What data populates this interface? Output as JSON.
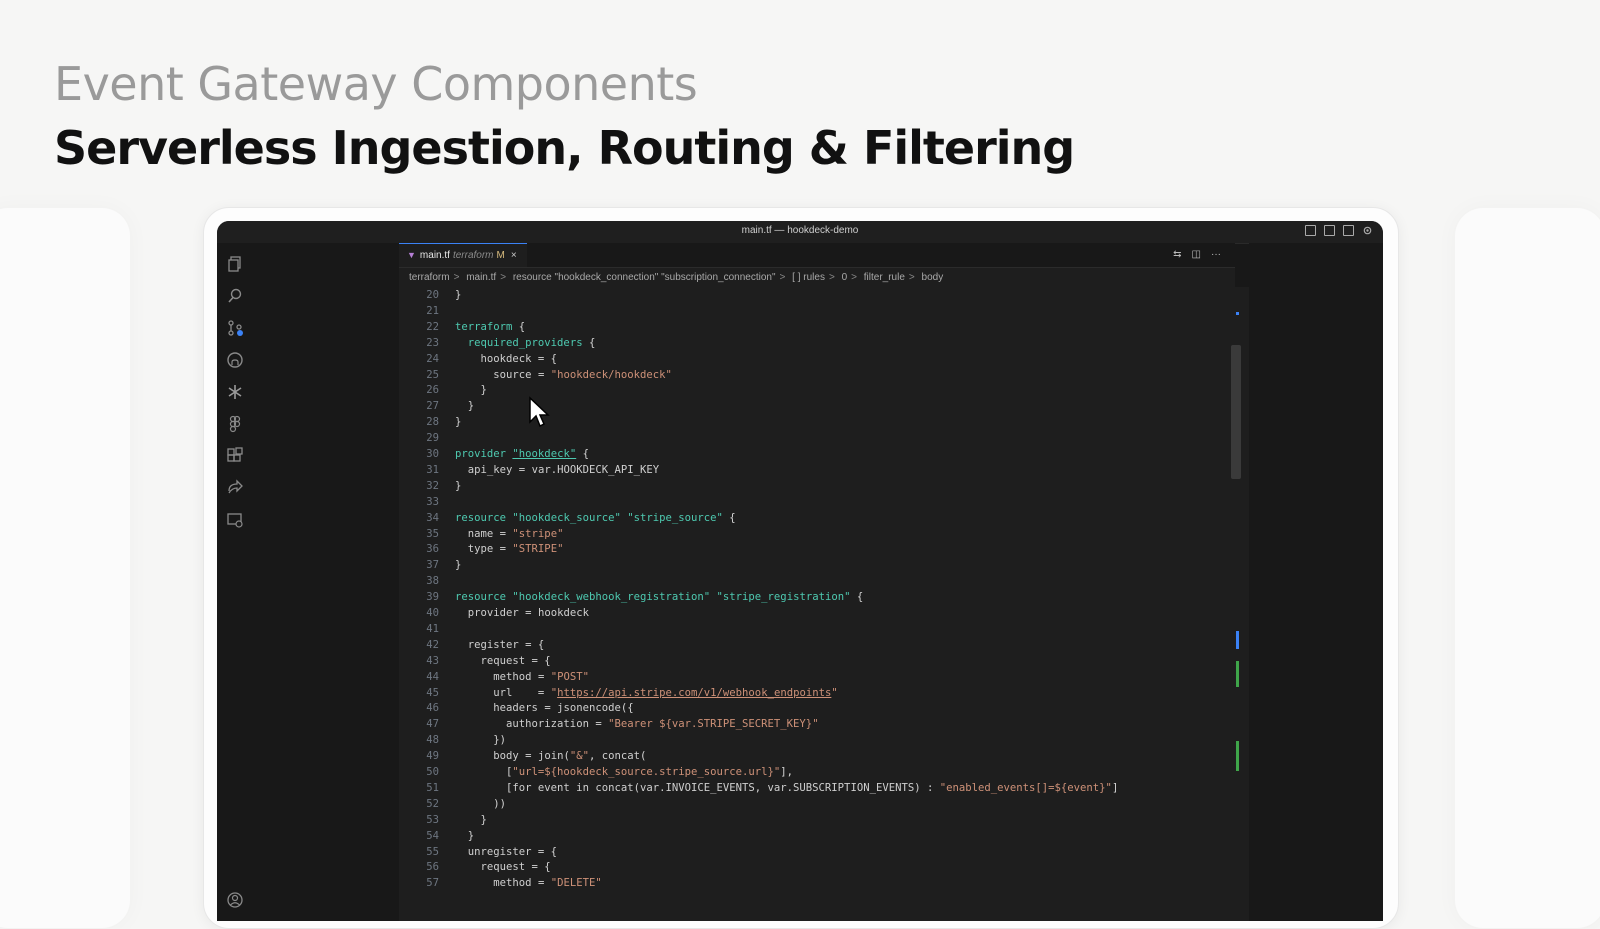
{
  "heading": {
    "supertitle": "Event Gateway Components",
    "title": "Serverless Ingestion, Routing & Filtering"
  },
  "window": {
    "title": "main.tf — hookdeck-demo"
  },
  "tab": {
    "icon": "terraform-icon",
    "filename": "main.tf",
    "language": "terraform",
    "status": "M",
    "close": "×"
  },
  "breadcrumb": [
    "terraform",
    "main.tf",
    "resource \"hookdeck_connection\" \"subscription_connection\"",
    "[ ] rules",
    "0",
    "filter_rule",
    "body"
  ],
  "code_lines": [
    {
      "n": "20",
      "parts": [
        [
          "pun",
          "}"
        ]
      ]
    },
    {
      "n": "21",
      "parts": []
    },
    {
      "n": "22",
      "parts": [
        [
          "kw",
          "terraform"
        ],
        [
          "pun",
          " {"
        ]
      ]
    },
    {
      "n": "23",
      "parts": [
        [
          "pun",
          "  "
        ],
        [
          "kw",
          "required_providers"
        ],
        [
          "pun",
          " {"
        ]
      ]
    },
    {
      "n": "24",
      "parts": [
        [
          "pun",
          "    "
        ],
        [
          "prop",
          "hookdeck"
        ],
        [
          "pun",
          " = {"
        ]
      ]
    },
    {
      "n": "25",
      "parts": [
        [
          "pun",
          "      "
        ],
        [
          "prop",
          "source"
        ],
        [
          "pun",
          " = "
        ],
        [
          "str",
          "\"hookdeck/hookdeck\""
        ]
      ]
    },
    {
      "n": "26",
      "parts": [
        [
          "pun",
          "    }"
        ]
      ]
    },
    {
      "n": "27",
      "parts": [
        [
          "pun",
          "  }"
        ]
      ]
    },
    {
      "n": "28",
      "parts": [
        [
          "pun",
          "}"
        ]
      ]
    },
    {
      "n": "29",
      "parts": []
    },
    {
      "n": "30",
      "parts": [
        [
          "kw",
          "provider"
        ],
        [
          "pun",
          " "
        ],
        [
          "link",
          "\"hookdeck\""
        ],
        [
          "pun",
          " {"
        ]
      ]
    },
    {
      "n": "31",
      "parts": [
        [
          "pun",
          "  "
        ],
        [
          "prop",
          "api_key"
        ],
        [
          "pun",
          " = "
        ],
        [
          "prop",
          "var.HOOKDECK_API_KEY"
        ]
      ]
    },
    {
      "n": "32",
      "parts": [
        [
          "pun",
          "}"
        ]
      ]
    },
    {
      "n": "33",
      "parts": []
    },
    {
      "n": "34",
      "parts": [
        [
          "kw",
          "resource"
        ],
        [
          "pun",
          " "
        ],
        [
          "kw",
          "\"hookdeck_source\""
        ],
        [
          "pun",
          " "
        ],
        [
          "kw",
          "\"stripe_source\""
        ],
        [
          "pun",
          " {"
        ]
      ]
    },
    {
      "n": "35",
      "parts": [
        [
          "pun",
          "  "
        ],
        [
          "prop",
          "name"
        ],
        [
          "pun",
          " = "
        ],
        [
          "str",
          "\"stripe\""
        ]
      ]
    },
    {
      "n": "36",
      "parts": [
        [
          "pun",
          "  "
        ],
        [
          "prop",
          "type"
        ],
        [
          "pun",
          " = "
        ],
        [
          "str",
          "\"STRIPE\""
        ]
      ]
    },
    {
      "n": "37",
      "parts": [
        [
          "pun",
          "}"
        ]
      ]
    },
    {
      "n": "38",
      "parts": []
    },
    {
      "n": "39",
      "parts": [
        [
          "kw",
          "resource"
        ],
        [
          "pun",
          " "
        ],
        [
          "kw",
          "\"hookdeck_webhook_registration\""
        ],
        [
          "pun",
          " "
        ],
        [
          "kw",
          "\"stripe_registration\""
        ],
        [
          "pun",
          " {"
        ]
      ]
    },
    {
      "n": "40",
      "parts": [
        [
          "pun",
          "  "
        ],
        [
          "prop",
          "provider"
        ],
        [
          "pun",
          " = "
        ],
        [
          "prop",
          "hookdeck"
        ]
      ]
    },
    {
      "n": "41",
      "parts": []
    },
    {
      "n": "42",
      "parts": [
        [
          "pun",
          "  "
        ],
        [
          "prop",
          "register"
        ],
        [
          "pun",
          " = {"
        ]
      ]
    },
    {
      "n": "43",
      "parts": [
        [
          "pun",
          "    "
        ],
        [
          "prop",
          "request"
        ],
        [
          "pun",
          " = {"
        ]
      ]
    },
    {
      "n": "44",
      "parts": [
        [
          "pun",
          "      "
        ],
        [
          "prop",
          "method"
        ],
        [
          "pun",
          " = "
        ],
        [
          "str",
          "\"POST\""
        ]
      ]
    },
    {
      "n": "45",
      "parts": [
        [
          "pun",
          "      "
        ],
        [
          "prop",
          "url"
        ],
        [
          "pun",
          "    = "
        ],
        [
          "str",
          "\""
        ],
        [
          "url",
          "https://api.stripe.com/v1/webhook_endpoints"
        ],
        [
          "str",
          "\""
        ]
      ]
    },
    {
      "n": "46",
      "parts": [
        [
          "pun",
          "      "
        ],
        [
          "prop",
          "headers"
        ],
        [
          "pun",
          " = "
        ],
        [
          "prop",
          "jsonencode"
        ],
        [
          "pun",
          "({"
        ]
      ]
    },
    {
      "n": "47",
      "parts": [
        [
          "pun",
          "        "
        ],
        [
          "prop",
          "authorization"
        ],
        [
          "pun",
          " = "
        ],
        [
          "str",
          "\"Bearer ${var.STRIPE_SECRET_KEY}\""
        ]
      ]
    },
    {
      "n": "48",
      "parts": [
        [
          "pun",
          "      })"
        ]
      ]
    },
    {
      "n": "49",
      "parts": [
        [
          "pun",
          "      "
        ],
        [
          "prop",
          "body"
        ],
        [
          "pun",
          " = "
        ],
        [
          "prop",
          "join"
        ],
        [
          "pun",
          "("
        ],
        [
          "str",
          "\"&\""
        ],
        [
          "pun",
          ", "
        ],
        [
          "prop",
          "concat"
        ],
        [
          "pun",
          "("
        ]
      ]
    },
    {
      "n": "50",
      "parts": [
        [
          "pun",
          "        ["
        ],
        [
          "str",
          "\"url=${hookdeck_source.stripe_source.url}\""
        ],
        [
          "pun",
          "],"
        ]
      ]
    },
    {
      "n": "51",
      "parts": [
        [
          "pun",
          "        ["
        ],
        [
          "prop",
          "for event in concat(var.INVOICE_EVENTS, var.SUBSCRIPTION_EVENTS) : "
        ],
        [
          "str",
          "\"enabled_events[]=${event}\""
        ],
        [
          "pun",
          "]"
        ]
      ]
    },
    {
      "n": "52",
      "parts": [
        [
          "pun",
          "      ))"
        ]
      ]
    },
    {
      "n": "53",
      "parts": [
        [
          "pun",
          "    }"
        ]
      ]
    },
    {
      "n": "54",
      "parts": [
        [
          "pun",
          "  }"
        ]
      ]
    },
    {
      "n": "55",
      "parts": [
        [
          "pun",
          "  "
        ],
        [
          "prop",
          "unregister"
        ],
        [
          "pun",
          " = {"
        ]
      ]
    },
    {
      "n": "56",
      "parts": [
        [
          "pun",
          "    "
        ],
        [
          "prop",
          "request"
        ],
        [
          "pun",
          " = {"
        ]
      ]
    },
    {
      "n": "57",
      "parts": [
        [
          "pun",
          "      "
        ],
        [
          "prop",
          "method"
        ],
        [
          "pun",
          " = "
        ],
        [
          "str",
          "\"DELETE\""
        ]
      ]
    }
  ],
  "colors": {
    "keyword": "#4ec9b0",
    "string": "#ce9178",
    "accent": "#3b82f6"
  }
}
